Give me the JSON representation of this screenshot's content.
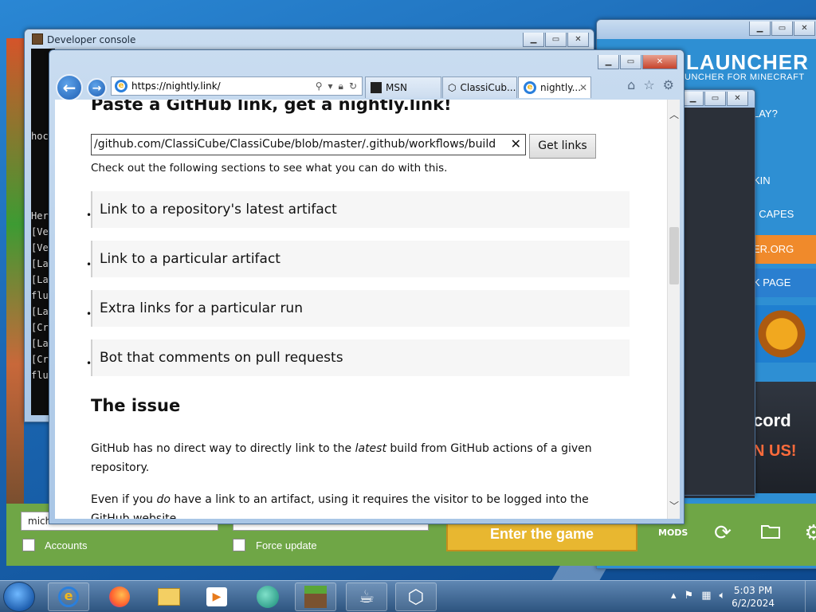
{
  "launcher": {
    "brand": "LAUNCHER",
    "subtitle": "UNCHER FOR MINECRAFT",
    "menu": [
      "LAY?",
      "",
      "KIN",
      "I CAPES",
      "ER.ORG",
      "K PAGE"
    ],
    "discord_line1": "cord",
    "discord_line2": "N US!",
    "username_value": "mich",
    "version_value": "",
    "accounts_label": "Accounts",
    "force_update_label": "Force update",
    "enter_button": "Enter the game",
    "mods_label": "MODS"
  },
  "console": {
    "title": "Developer console",
    "lines": [
      "",
      "",
      "",
      "",
      "",
      "hoc",
      "",
      "",
      "",
      "",
      "Her",
      "[Ve",
      "[Ve",
      "[La",
      "[La",
      "flu",
      "[La",
      "[Cr",
      "[La",
      "[Cr",
      "flu"
    ]
  },
  "browser": {
    "address_url": "https://nightly.link/",
    "tabs": [
      {
        "label": "MSN",
        "icon": "msn-icon"
      },
      {
        "label": "ClassiCub...",
        "icon": "classicube-icon"
      },
      {
        "label": "nightly...",
        "icon": "ie-icon"
      }
    ]
  },
  "page": {
    "heading": "Paste a GitHub link, get a nightly.link!",
    "url_value": "/github.com/ClassiCube/ClassiCube/blob/master/.github/workflows/build",
    "get_links_label": "Get links",
    "hint": "Check out the following sections to see what you can do with this.",
    "sections": [
      "Link to a repository's latest artifact",
      "Link to a particular artifact",
      "Extra links for a particular run",
      "Bot that comments on pull requests"
    ],
    "issue_heading": "The issue",
    "para1_a": "GitHub has no direct way to directly link to the ",
    "para1_em": "latest",
    "para1_b": " build from GitHub actions of a given repository.",
    "para2_a": "Even if you ",
    "para2_em": "do",
    "para2_b": " have a link to an artifact, using it requires the visitor to be logged into the GitHub website."
  },
  "taskbar": {
    "time": "5:03 PM",
    "date": "6/2/2024"
  }
}
